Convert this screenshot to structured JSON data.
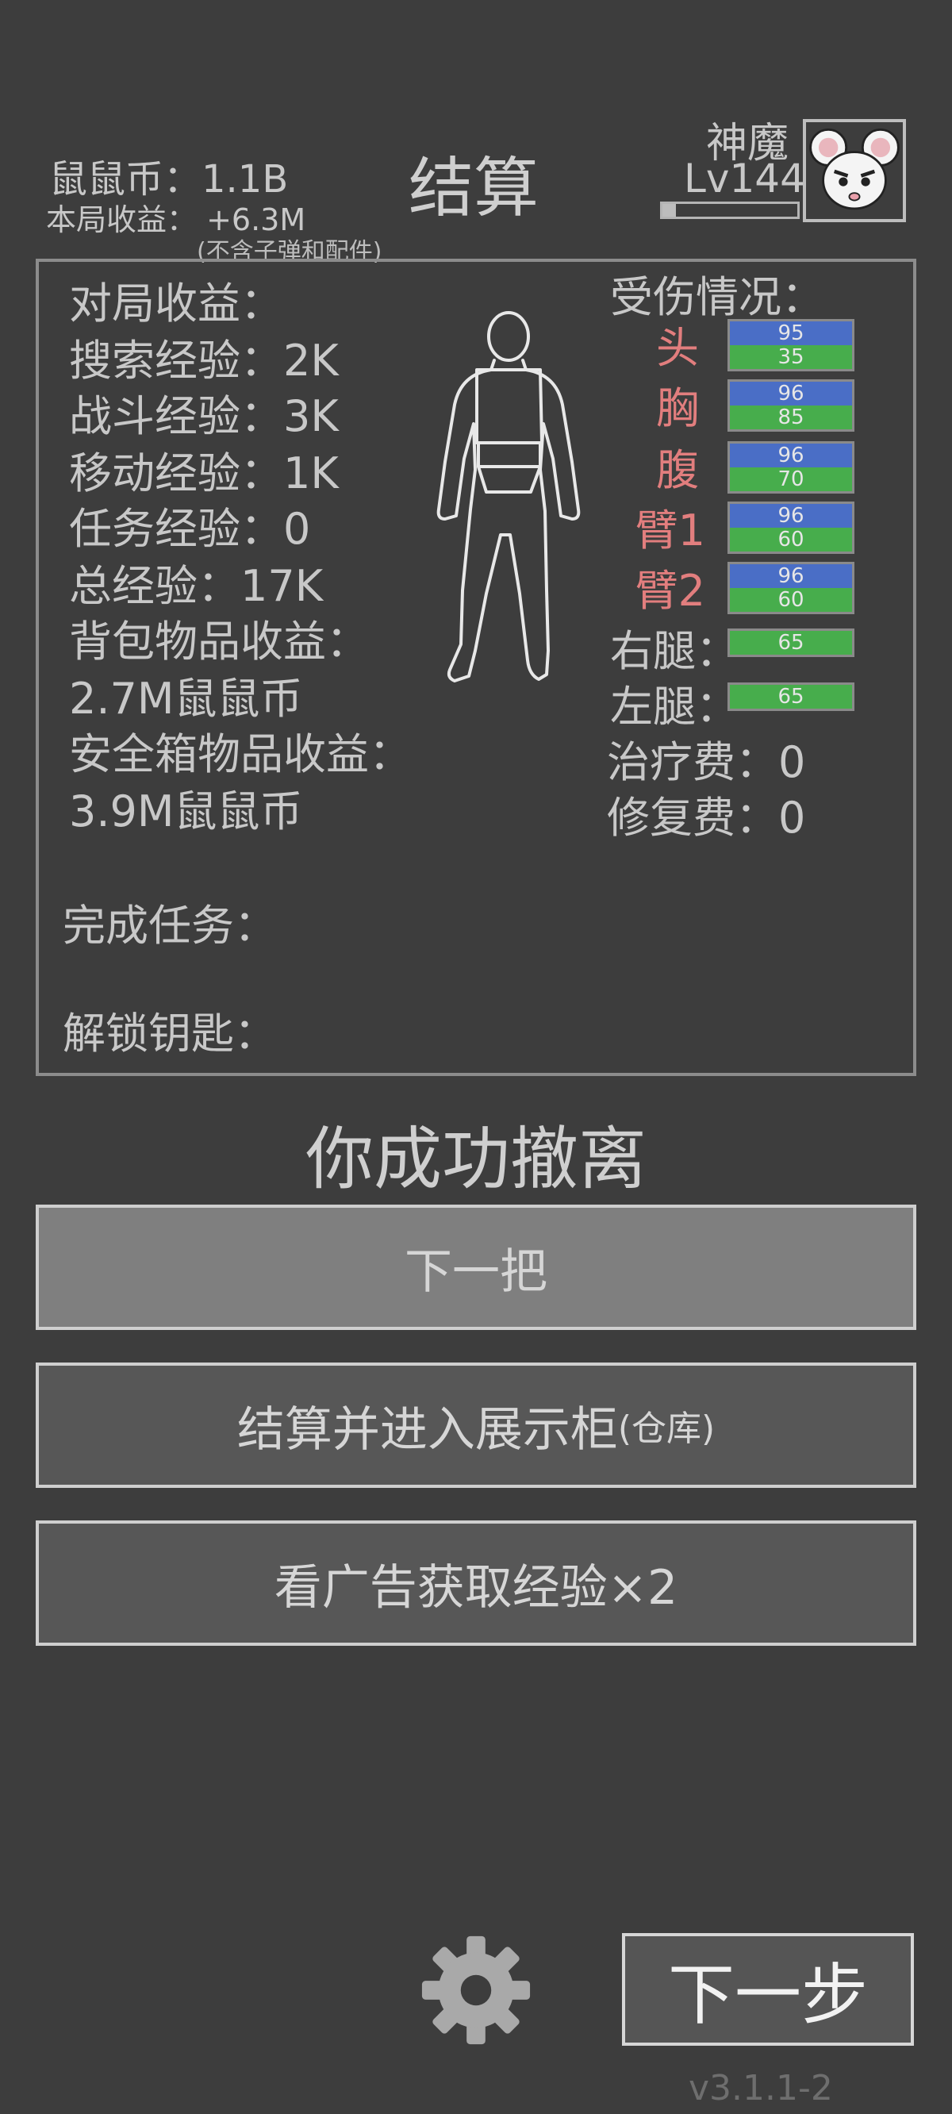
{
  "header": {
    "coins": "鼠鼠币：1.1B",
    "round_income": "本局收益： +6.3M",
    "income_note": "(不含子弹和配件)",
    "title": "结算",
    "player_name": "神魔",
    "player_level": "Lv144",
    "xp_progress": 0.1
  },
  "stats": [
    "对局收益：",
    "搜索经验：2K",
    "战斗经验：3K",
    "移动经验：1K",
    "任务经验：0",
    "总经验：17K",
    "背包物品收益：",
    "2.7M鼠鼠币",
    "安全箱物品收益：",
    "3.9M鼠鼠币",
    "完成任务：",
    "解锁钥匙："
  ],
  "injury": {
    "title": "受伤情况：",
    "parts": [
      {
        "label": "头",
        "armor": "95",
        "health": "35"
      },
      {
        "label": "胸",
        "armor": "96",
        "health": "85"
      },
      {
        "label": "腹",
        "armor": "96",
        "health": "70"
      },
      {
        "label": "臂1",
        "armor": "96",
        "health": "60"
      },
      {
        "label": "臂2",
        "armor": "96",
        "health": "60"
      }
    ],
    "legs": [
      {
        "label": "右腿：",
        "health": "65"
      },
      {
        "label": "左腿：",
        "health": "65"
      }
    ],
    "heal_cost": "治疗费：0",
    "repair_cost": "修复费：0",
    "colors": {
      "damaged_label": "#e27e7e",
      "armor_bar": "#4a6ec6",
      "health_bar": "#47ad4c"
    }
  },
  "result_text": "你成功撤离",
  "buttons": {
    "next_round": "下一把",
    "settle_main": "结算并进入展示柜",
    "settle_sub": "(仓库)",
    "watch_ad": "看广告获取经验×2",
    "next_step": "下一步"
  },
  "icons": {
    "settings": "gear-icon",
    "avatar": "mouse-avatar-icon"
  },
  "version": "v3.1.1-2"
}
